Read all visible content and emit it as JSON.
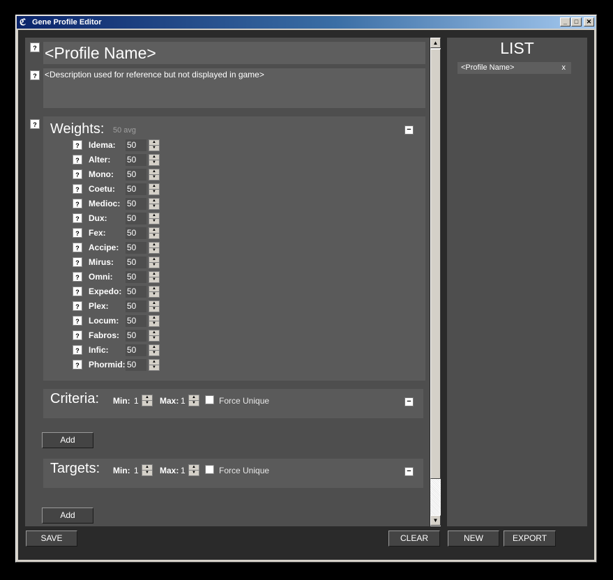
{
  "window": {
    "title": "Gene Profile Editor",
    "minimize": "_",
    "maximize": "□",
    "close": "✕",
    "app_icon": "app-logo-icon"
  },
  "profile": {
    "help": "?",
    "name": "<Profile Name>",
    "description": "<Description used for reference but not displayed in game>"
  },
  "weights": {
    "help": "?",
    "title": "Weights:",
    "avg": "50 avg",
    "collapse": "−",
    "items": [
      {
        "label": "Idema:",
        "value": "50"
      },
      {
        "label": "Alter:",
        "value": "50"
      },
      {
        "label": "Mono:",
        "value": "50"
      },
      {
        "label": "Coetu:",
        "value": "50"
      },
      {
        "label": "Medioc:",
        "value": "50"
      },
      {
        "label": "Dux:",
        "value": "50"
      },
      {
        "label": "Fex:",
        "value": "50"
      },
      {
        "label": "Accipe:",
        "value": "50"
      },
      {
        "label": "Mirus:",
        "value": "50"
      },
      {
        "label": "Omni:",
        "value": "50"
      },
      {
        "label": "Expedo:",
        "value": "50"
      },
      {
        "label": "Plex:",
        "value": "50"
      },
      {
        "label": "Locum:",
        "value": "50"
      },
      {
        "label": "Fabros:",
        "value": "50"
      },
      {
        "label": "Infic:",
        "value": "50"
      },
      {
        "label": "Phormid:",
        "value": "50"
      }
    ],
    "item_help": "?"
  },
  "criteria": {
    "title": "Criteria:",
    "min_label": "Min:",
    "min_value": "1",
    "max_label": "Max:",
    "max_value": "1",
    "force_unique": "Force Unique",
    "force_unique_checked": false,
    "collapse": "−",
    "add_button": "Add"
  },
  "targets": {
    "title": "Targets:",
    "min_label": "Min:",
    "min_value": "1",
    "max_label": "Max:",
    "max_value": "1",
    "force_unique": "Force Unique",
    "force_unique_checked": false,
    "collapse": "−",
    "add_button": "Add"
  },
  "scrollbar": {
    "up": "▲",
    "down": "▼"
  },
  "footer": {
    "save": "SAVE",
    "clear": "CLEAR",
    "new": "NEW",
    "export": "EXPORT"
  },
  "list": {
    "title": "LIST",
    "items": [
      {
        "label": "<Profile Name>",
        "remove": "x"
      }
    ]
  },
  "colors": {
    "background": "#2a2a2a",
    "panel": "#4e4e4e",
    "field": "#5e5e5e",
    "text": "#ffffff",
    "titlebar_start": "#0a246a",
    "titlebar_end": "#a6caf0"
  }
}
